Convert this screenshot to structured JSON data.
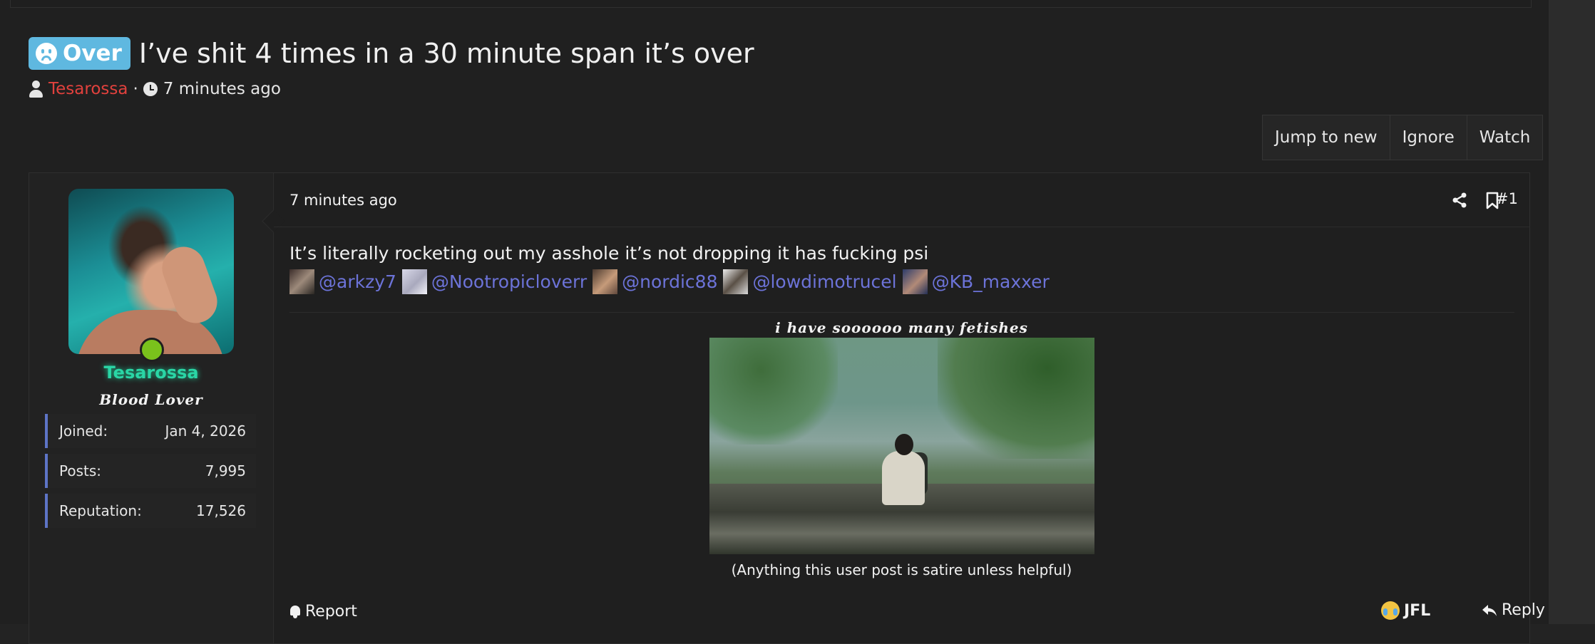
{
  "thread": {
    "prefix": "Over",
    "title": "I’ve shit 4 times in a 30 minute span it’s over",
    "author": "Tesarossa",
    "separator": "·",
    "time": "7 minutes ago"
  },
  "actions": {
    "jump_to_new": "Jump to new",
    "ignore": "Ignore",
    "watch": "Watch"
  },
  "post": {
    "time": "7 minutes ago",
    "number": "#1",
    "text": "It’s literally rocketing out my asshole it’s not dropping it has fucking psi",
    "mentions": [
      "@arkzy7",
      "@Nootropicloverr",
      "@nordic88",
      "@lowdimotrucel",
      "@KB_maxxer"
    ],
    "signature_caption": "i have soooooo many fetishes",
    "signature_note": "(Anything this user post is satire unless helpful)",
    "report_label": "Report",
    "reaction_label": "JFL",
    "reply_label": "Reply"
  },
  "user": {
    "name": "Tesarossa",
    "title": "Blood Lover",
    "stats": [
      {
        "label": "Joined:",
        "value": "Jan 4, 2026"
      },
      {
        "label": "Posts:",
        "value": "7,995"
      },
      {
        "label": "Reputation:",
        "value": "17,526"
      }
    ]
  },
  "colors": {
    "prefix_badge": "#5fb8e0",
    "author_link": "#e2413d",
    "username": "#2ad6a6",
    "mention": "#6c73d8",
    "stat_accent": "#5d74c6",
    "online": "#7ac21c"
  },
  "icons": [
    "sad-face-icon",
    "user-icon",
    "clock-icon",
    "share-icon",
    "bookmark-icon",
    "bell-icon",
    "crying-laughing-emoji-icon",
    "reply-icon"
  ]
}
